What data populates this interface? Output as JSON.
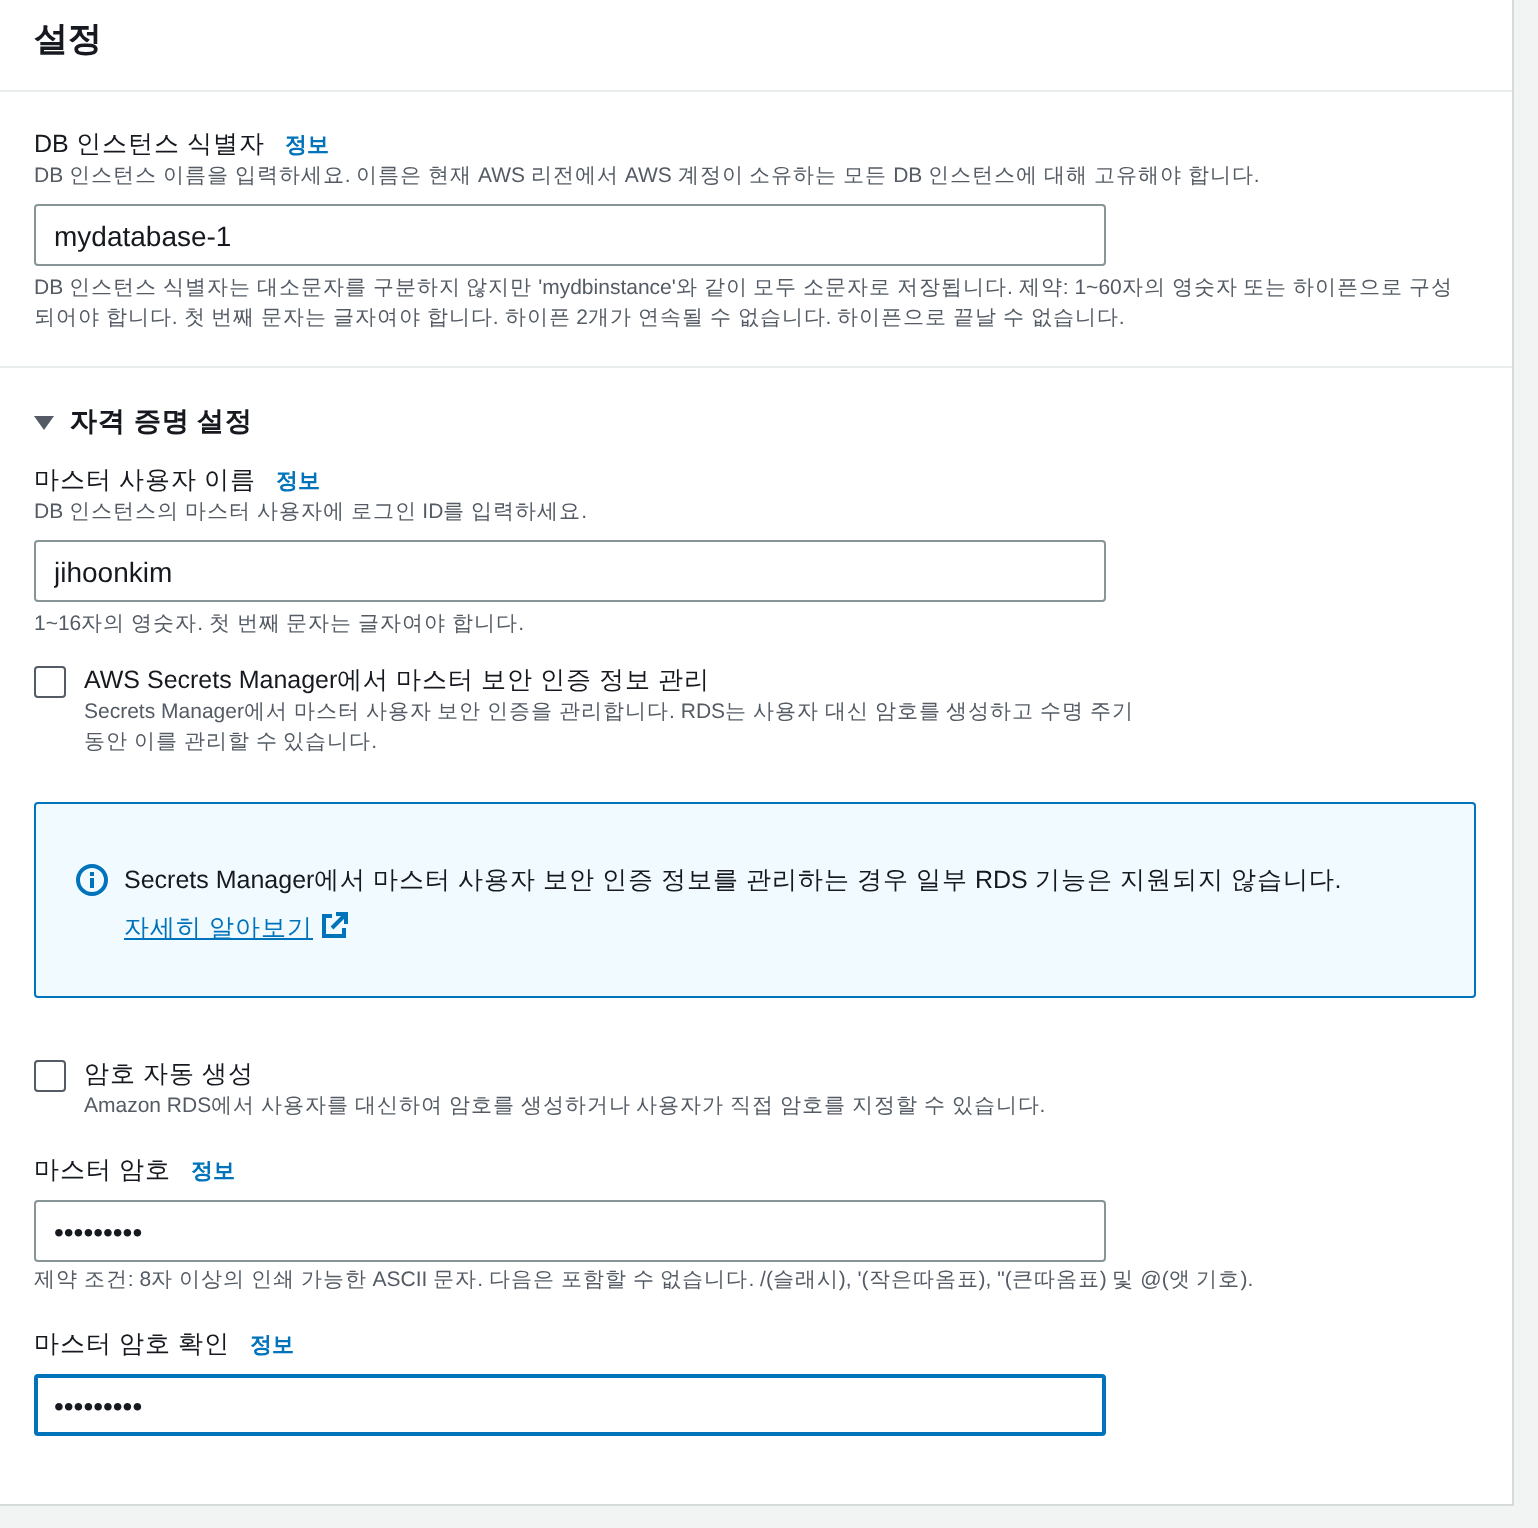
{
  "header": {
    "title": "설정"
  },
  "identifier": {
    "label": "DB 인스턴스 식별자",
    "info": "정보",
    "description": "DB 인스턴스 이름을 입력하세요. 이름은 현재 AWS 리전에서 AWS 계정이 소유하는 모든 DB 인스턴스에 대해 고유해야 합니다.",
    "value": "mydatabase-1",
    "focused": false,
    "constraint": "DB 인스턴스 식별자는 대소문자를 구분하지 않지만 'mydbinstance'와 같이 모두 소문자로 저장됩니다. 제약: 1~60자의 영숫자 또는 하이픈으로 구성되어야 합니다. 첫 번째 문자는 글자여야 합니다. 하이픈 2개가 연속될 수 없습니다. 하이픈으로 끝날 수 없습니다."
  },
  "credentials": {
    "title": "자격 증명 설정",
    "expanded": true,
    "fields": [
      {
        "kind": "input",
        "label": "마스터 사용자 이름",
        "info": "정보",
        "description": "DB 인스턴스의 마스터 사용자에 로그인 ID를 입력하세요.",
        "value": "jihoonkim",
        "focused": false,
        "constraint": "1~16자의 영숫자. 첫 번째 문자는 글자여야 합니다."
      },
      {
        "kind": "checkbox",
        "label": "AWS Secrets Manager에서 마스터 보안 인증 정보 관리",
        "checked": false,
        "description": "Secrets Manager에서 마스터 사용자 보안 인증을 관리합니다. RDS는 사용자 대신 암호를 생성하고 수명 주기 동안 이를 관리할 수 있습니다."
      },
      {
        "kind": "alert",
        "text": "Secrets Manager에서 마스터 사용자 보안 인증 정보를 관리하는 경우 일부 RDS 기능은 지원되지 않습니다.",
        "link": "자세히 알아보기"
      },
      {
        "kind": "checkbox",
        "label": "암호 자동 생성",
        "checked": false,
        "description": "Amazon RDS에서 사용자를 대신하여 암호를 생성하거나 사용자가 직접 암호를 지정할 수 있습니다."
      },
      {
        "kind": "input",
        "label": "마스터 암호",
        "info": "정보",
        "value": "•••••••••",
        "focused": false,
        "constraint": "제약 조건: 8자 이상의 인쇄 가능한 ASCII 문자. 다음은 포함할 수 없습니다. /(슬래시), '(작은따옴표), \"(큰따옴표) 및 @(앳 기호)."
      },
      {
        "kind": "input",
        "label": "마스터 암호 확인",
        "info": "정보",
        "value": "•••••••••",
        "focused": true
      }
    ]
  }
}
